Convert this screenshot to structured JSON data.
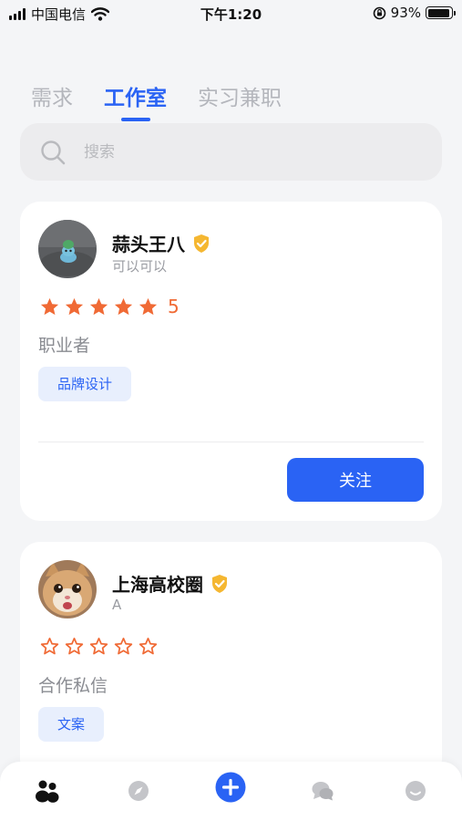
{
  "status_bar": {
    "carrier": "中国电信",
    "time": "下午1:20",
    "battery": "93%",
    "battery_level": 0.93
  },
  "tabs": [
    {
      "label": "需求",
      "active": false
    },
    {
      "label": "工作室",
      "active": true
    },
    {
      "label": "实习兼职",
      "active": false
    }
  ],
  "search": {
    "placeholder": "搜索",
    "value": ""
  },
  "cards": [
    {
      "name": "蒜头王八",
      "subtitle": "可以可以",
      "rating": 5,
      "rating_label": "5",
      "role": "职业者",
      "tag": "品牌设计",
      "follow_label": "关注",
      "verified": true
    },
    {
      "name": "上海高校圈",
      "subtitle": "A",
      "rating": 0,
      "role": "合作私信",
      "tag": "文案",
      "verified": true
    }
  ],
  "colors": {
    "accent": "#2a63f4",
    "star": "#f06a35",
    "badge": "#f5b731",
    "tag_bg": "#e8effd"
  },
  "bottom_nav": [
    {
      "icon": "people-icon",
      "active": true
    },
    {
      "icon": "compass-icon",
      "active": false
    },
    {
      "icon": "plus-circle-icon",
      "active": false
    },
    {
      "icon": "chat-bubbles-icon",
      "active": false
    },
    {
      "icon": "profile-face-icon",
      "active": false
    }
  ]
}
